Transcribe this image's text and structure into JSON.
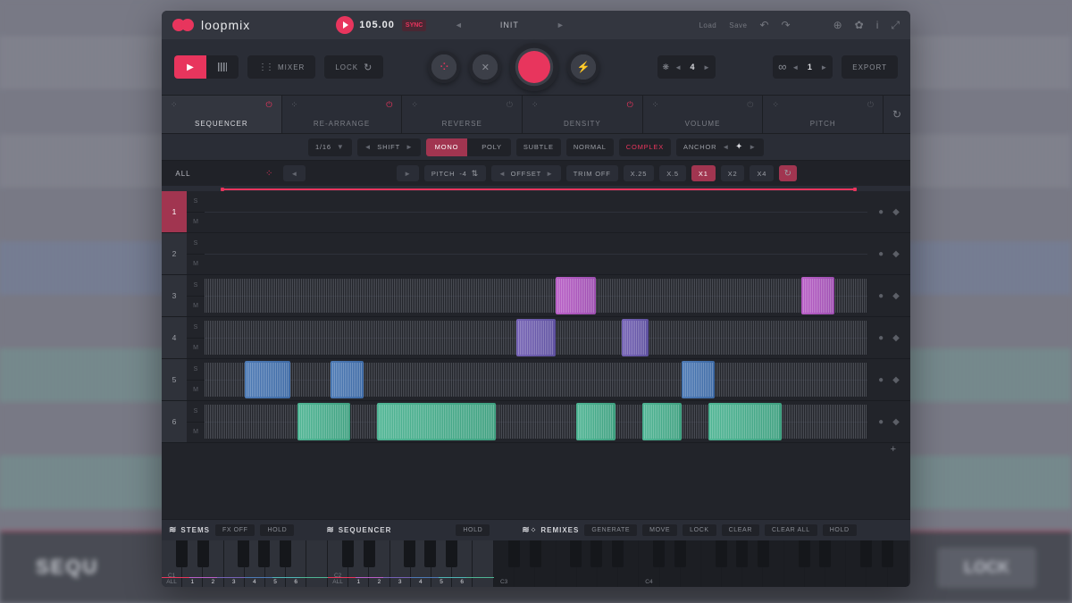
{
  "app": {
    "name": "loopmix"
  },
  "top": {
    "tempo": "105.00",
    "sync": "SYNC",
    "preset": "INIT",
    "load": "Load",
    "save": "Save"
  },
  "transport": {
    "mixer": "MIXER",
    "lock": "LOCK",
    "steps_a": "4",
    "steps_b": "1",
    "export": "EXPORT"
  },
  "tabs": [
    "SEQUENCER",
    "RE-ARRANGE",
    "REVERSE",
    "DENSITY",
    "VOLUME",
    "PITCH"
  ],
  "seq_controls": {
    "grid": "1/16",
    "shift": "SHIFT",
    "mono": "MONO",
    "poly": "POLY",
    "subtle": "SUBTLE",
    "normal": "NORMAL",
    "complex": "COMPLEX",
    "anchor": "ANCHOR"
  },
  "track_head": {
    "all": "ALL",
    "pitch": "PITCH",
    "pitch_val": "-4",
    "offset": "OFFSET",
    "trim": "TRIM OFF",
    "x025": "X.25",
    "x05": "X.5",
    "x1": "X1",
    "x2": "X2",
    "x4": "X4"
  },
  "tracks": {
    "s": "S",
    "m": "M",
    "nums": [
      "1",
      "2",
      "3",
      "4",
      "5",
      "6"
    ]
  },
  "bottom": {
    "stems": "STEMS",
    "fxoff": "FX OFF",
    "hold": "HOLD",
    "sequencer": "SEQUENCER",
    "remixes": "REMIXES",
    "generate": "GENERATE",
    "move": "MOVE",
    "lock": "LOCK",
    "clear": "CLEAR",
    "clearall": "CLEAR ALL"
  },
  "keyboard": {
    "c1": "C1",
    "c2": "C2",
    "c3": "C3",
    "c4": "C4",
    "all": "ALL",
    "k1": "1",
    "k2": "2",
    "k3": "3",
    "k4": "4",
    "k5": "5",
    "k6": "6"
  },
  "bg": {
    "seq": "SEQU",
    "lock": "LOCK"
  }
}
